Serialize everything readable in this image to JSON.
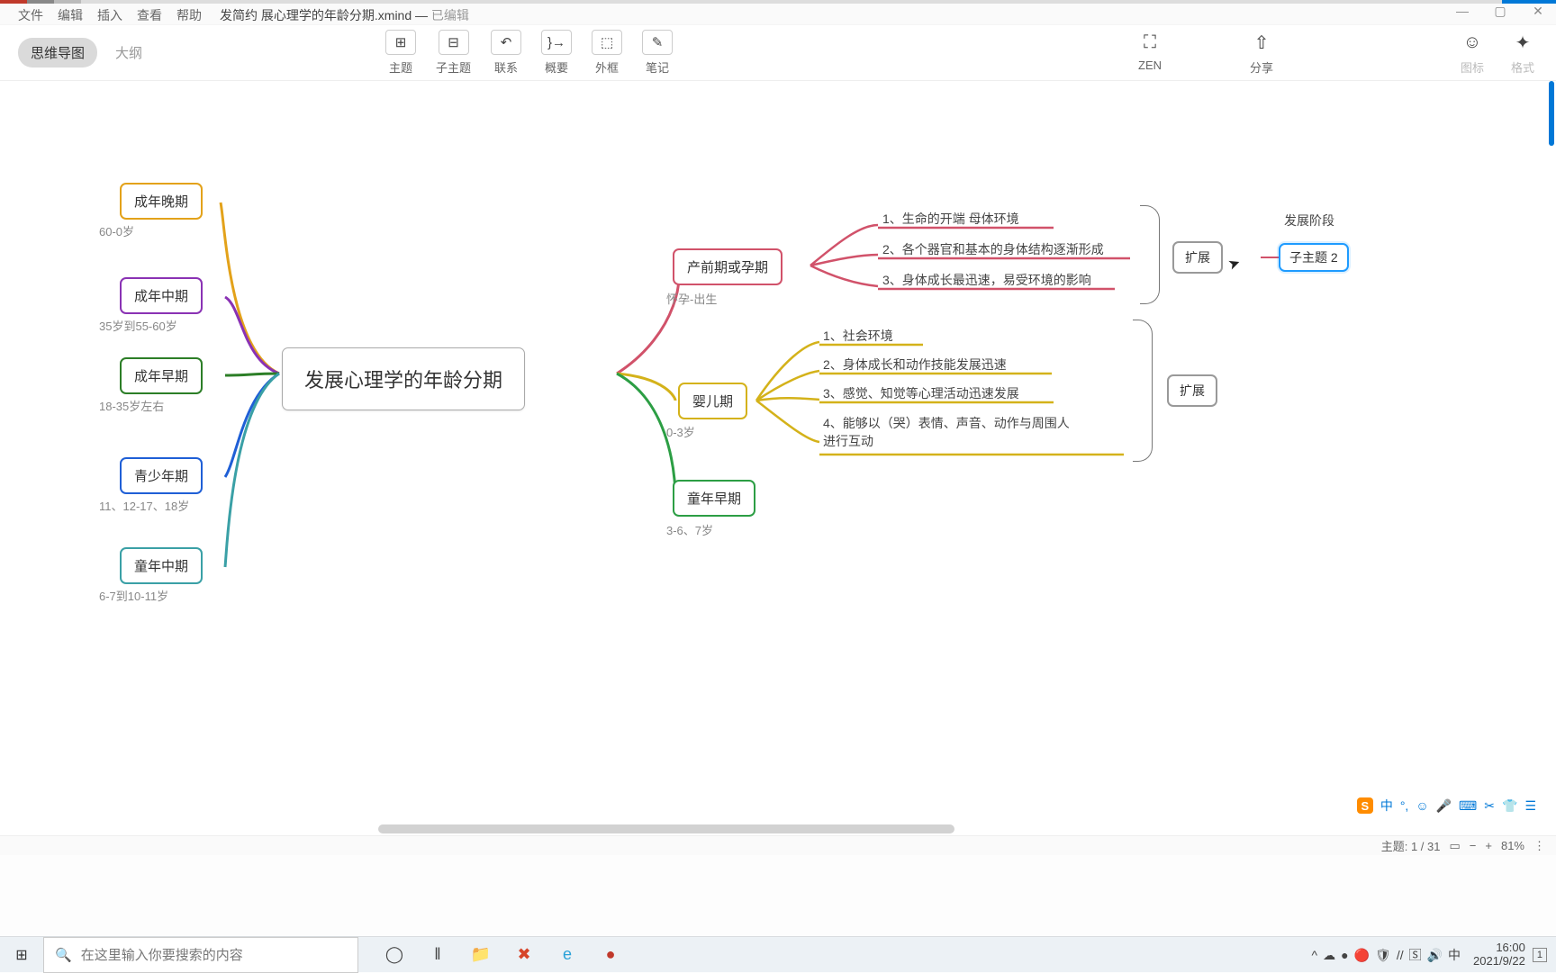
{
  "app": {
    "menus": [
      "文件",
      "编辑",
      "插入",
      "查看",
      "帮助"
    ],
    "doc_name": "发简约 展心理学的年龄分期.xmind",
    "doc_status": "已编辑",
    "window": {
      "min": "—",
      "max": "▢",
      "close": "✕"
    }
  },
  "toolbar": {
    "view_mindmap": "思维导图",
    "view_outline": "大纲",
    "items": [
      {
        "icon": "⊞",
        "label": "主题"
      },
      {
        "icon": "⊟",
        "label": "子主题"
      },
      {
        "icon": "↶",
        "label": "联系"
      },
      {
        "icon": "}→",
        "label": "概要"
      },
      {
        "icon": "⬚",
        "label": "外框"
      },
      {
        "icon": "✎",
        "label": "笔记"
      }
    ],
    "right1": [
      {
        "icon": "⛶",
        "label": "ZEN"
      },
      {
        "icon": "⇧",
        "label": "分享"
      }
    ],
    "right2": [
      {
        "icon": "☺",
        "label": "图标"
      },
      {
        "icon": "✦",
        "label": "格式"
      }
    ]
  },
  "mindmap": {
    "center": "发展心理学的年龄分期",
    "left": [
      {
        "title": "成年晚期",
        "sub": "60-0岁",
        "color": "#e3a21a"
      },
      {
        "title": "成年中期",
        "sub": "35岁到55-60岁",
        "color": "#8a32b4"
      },
      {
        "title": "成年早期",
        "sub": "18-35岁左右",
        "color": "#2c7e27"
      },
      {
        "title": "青少年期",
        "sub": "11、12-17、18岁",
        "color": "#1f5fd6"
      },
      {
        "title": "童年中期",
        "sub": "6-7到10-11岁",
        "color": "#3aa0a6"
      }
    ],
    "right": [
      {
        "title": "产前期或孕期",
        "sub": "怀孕-出生",
        "color": "#d1526a",
        "leaves": [
          "1、生命的开端 母体环境",
          "2、各个器官和基本的身体结构逐渐形成",
          "3、身体成长最迅速，易受环境的影响"
        ]
      },
      {
        "title": "婴儿期",
        "sub": "0-3岁",
        "color": "#d4b21a",
        "leaves": [
          "1、社会环境",
          "2、身体成长和动作技能发展迅速",
          "3、感觉、知觉等心理活动迅速发展",
          "4、能够以（哭）表情、声音、动作与周围人进行互动"
        ]
      },
      {
        "title": "童年早期",
        "sub": "3-6、7岁",
        "color": "#2c9e44",
        "leaves": []
      }
    ],
    "summary1": {
      "label": "扩展",
      "float": "发展阶段",
      "child": "子主题 2"
    },
    "summary2": {
      "label": "扩展"
    }
  },
  "ime": {
    "logo": "S",
    "items": [
      "中",
      "°,",
      "☺",
      "🎤",
      "⌨",
      "✂",
      "👕",
      "☰"
    ]
  },
  "status": {
    "topic": "主题: 1 / 31",
    "book": "▭",
    "minus": "−",
    "plus": "+",
    "zoom": "81%",
    "more": "⋮"
  },
  "taskbar": {
    "start": "⊞",
    "search_placeholder": "在这里输入你要搜索的内容",
    "icons": [
      "◯",
      "‖",
      "📁",
      "✖",
      "e",
      "●"
    ],
    "tray": [
      "^",
      "☁",
      "●",
      "🔴",
      "🛡",
      "//",
      "🅂",
      "🔊",
      "中"
    ],
    "time": "16:00",
    "date": "2021/9/22",
    "notif": "1"
  }
}
